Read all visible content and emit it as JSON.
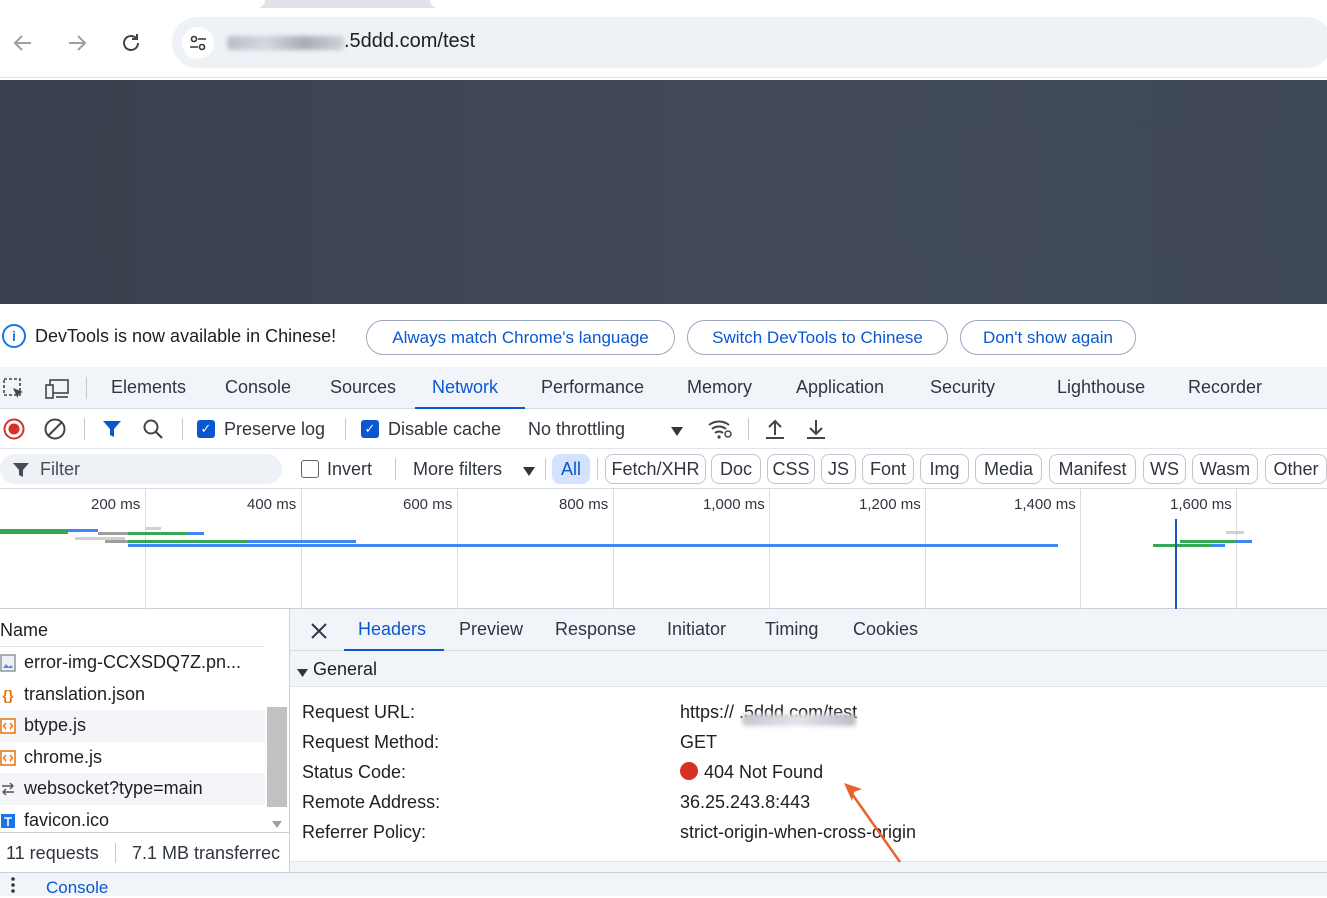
{
  "browser": {
    "url_visible": ".5ddd.com/test",
    "nav_back": "back-arrow-icon",
    "nav_forward": "forward-arrow-icon",
    "reload": "reload-icon"
  },
  "infobar": {
    "message": "DevTools is now available in Chinese!",
    "btn_match": "Always match Chrome's language",
    "btn_switch": "Switch DevTools to Chinese",
    "btn_dismiss": "Don't show again"
  },
  "panels": {
    "tabs": [
      "Elements",
      "Console",
      "Sources",
      "Network",
      "Performance",
      "Memory",
      "Application",
      "Security",
      "Lighthouse",
      "Recorder"
    ],
    "active": "Network"
  },
  "network_toolbar": {
    "preserve_log": "Preserve log",
    "disable_cache": "Disable cache",
    "throttling": "No throttling"
  },
  "filter": {
    "placeholder": "Filter",
    "invert": "Invert",
    "more_filters": "More filters",
    "types": [
      "All",
      "Fetch/XHR",
      "Doc",
      "CSS",
      "JS",
      "Font",
      "Img",
      "Media",
      "Manifest",
      "WS",
      "Wasm",
      "Other"
    ]
  },
  "timeline": {
    "ticks": [
      "200 ms",
      "400 ms",
      "600 ms",
      "800 ms",
      "1,000 ms",
      "1,200 ms",
      "1,400 ms",
      "1,600 ms"
    ]
  },
  "requests": {
    "header": "Name",
    "items": [
      {
        "name": "error-img-CCXSDQ7Z.pn...",
        "icon": "image-icon"
      },
      {
        "name": "translation.json",
        "icon": "json-icon"
      },
      {
        "name": "btype.js",
        "icon": "script-icon"
      },
      {
        "name": "chrome.js",
        "icon": "script-icon"
      },
      {
        "name": "websocket?type=main",
        "icon": "websocket-icon"
      },
      {
        "name": "favicon.ico",
        "icon": "image-icon"
      }
    ],
    "count": "11 requests",
    "transferred": "7.1 MB transferrec"
  },
  "details": {
    "tabs": [
      "Headers",
      "Preview",
      "Response",
      "Initiator",
      "Timing",
      "Cookies"
    ],
    "active": "Headers",
    "section": "General",
    "fields": [
      {
        "key": "Request URL:",
        "value": "https://            .5ddd.com/test"
      },
      {
        "key": "Request Method:",
        "value": "GET"
      },
      {
        "key": "Status Code:",
        "value": "404 Not Found"
      },
      {
        "key": "Remote Address:",
        "value": "36.25.243.8:443"
      },
      {
        "key": "Referrer Policy:",
        "value": "strict-origin-when-cross-origin"
      }
    ]
  },
  "drawer": {
    "label": "Console"
  },
  "colors": {
    "accent": "#0b57d0",
    "error": "#d93025",
    "annotation_arrow": "#e8622c"
  }
}
